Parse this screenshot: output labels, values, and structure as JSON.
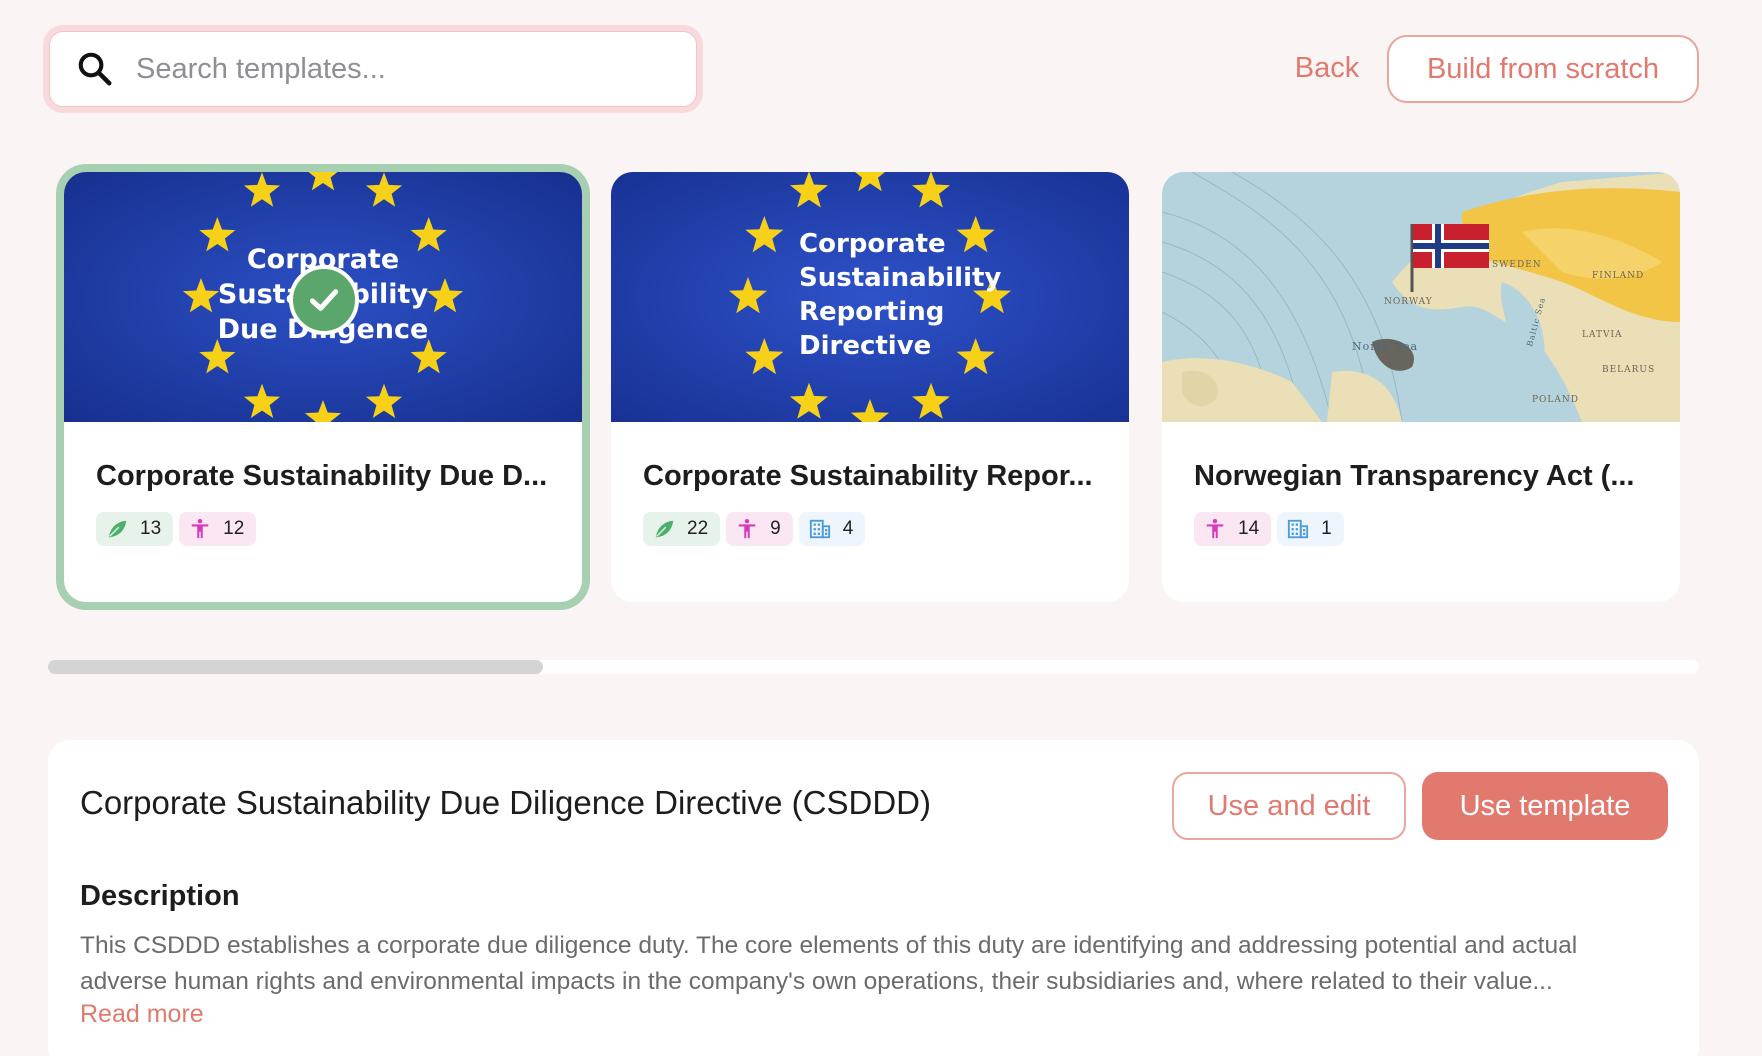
{
  "search": {
    "placeholder": "Search templates..."
  },
  "header": {
    "back_label": "Back",
    "build_label": "Build from scratch"
  },
  "cards": [
    {
      "image_text": [
        "Corporate",
        "Sustainability",
        "Due Diligence"
      ],
      "title": "Corporate Sustainability Due D...",
      "selected": true,
      "tags": {
        "environment": "13",
        "social": "12"
      }
    },
    {
      "image_text": [
        "Corporate",
        "Sustainability",
        "Reporting",
        "Directive"
      ],
      "title": "Corporate Sustainability Repor...",
      "selected": false,
      "tags": {
        "environment": "22",
        "social": "9",
        "governance": "4"
      }
    },
    {
      "image_text": [
        "NORWAY",
        "North Sea",
        "FINLAND",
        "SWEDEN",
        "LATVIA",
        "BELARUS",
        "POLAND",
        "Baltic Sea"
      ],
      "title": "Norwegian Transparency Act (...",
      "selected": false,
      "tags": {
        "social": "14",
        "governance": "1"
      }
    }
  ],
  "scrollbar": {
    "position": 0,
    "visible_fraction": 0.3
  },
  "details": {
    "title": "Corporate Sustainability Due Diligence Directive (CSDDD)",
    "use_edit_label": "Use and edit",
    "use_template_label": "Use template",
    "description_heading": "Description",
    "description": "This CSDDD establishes a corporate due diligence duty. The core elements of this duty are identifying and addressing potential and actual adverse human rights and environmental impacts in the company's own operations, their subsidiaries and, where related to their value...",
    "read_more": "Read more"
  },
  "colors": {
    "accent": "#e2796f",
    "selected_border": "#a7d0b2",
    "environment": "#4caf6a",
    "social": "#d63bbd",
    "governance": "#4b9bdb",
    "eu_blue": "#1f3fb4",
    "eu_star": "#f7d117"
  }
}
